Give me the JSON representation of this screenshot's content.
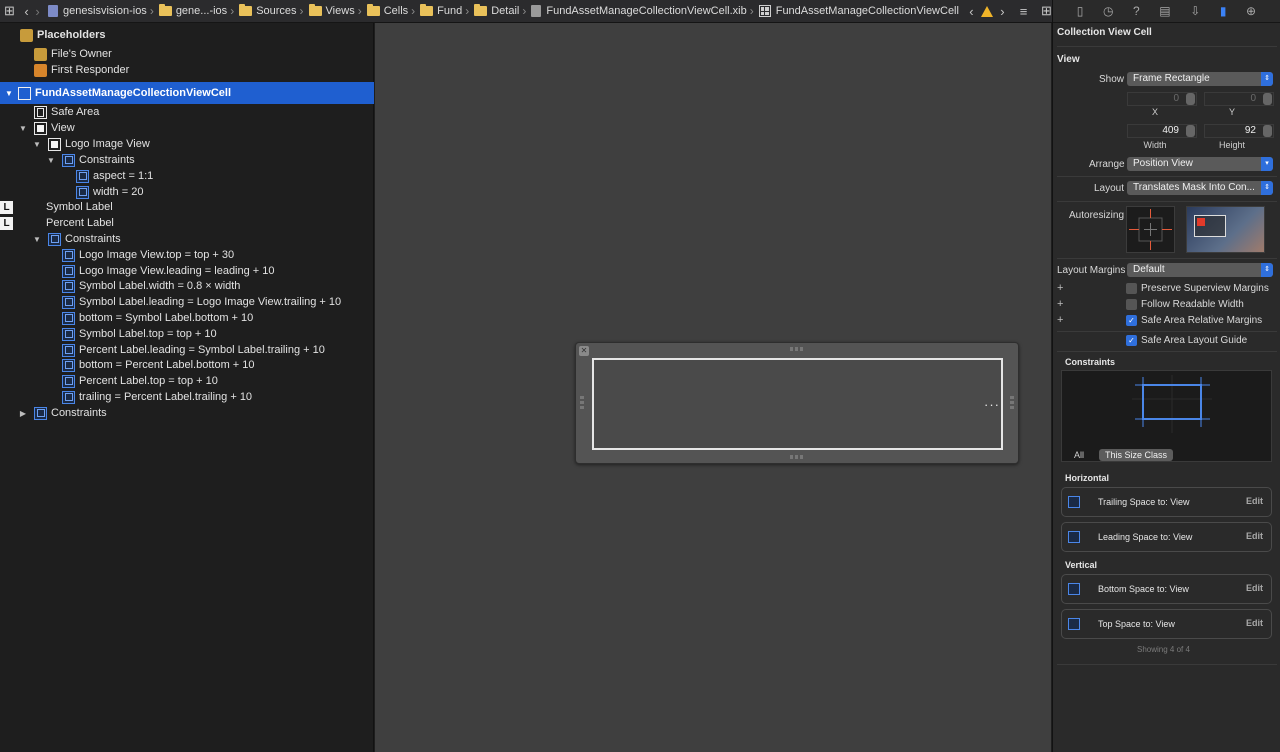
{
  "jumpbar": {
    "crumbs": [
      "genesisvision-ios",
      "gene...-ios",
      "Sources",
      "Views",
      "Cells",
      "Fund",
      "Detail",
      "FundAssetManageCollectionViewCell.xib",
      "FundAssetManageCollectionViewCell"
    ]
  },
  "outline": {
    "placeholders": "Placeholders",
    "files_owner": "File's Owner",
    "first_responder": "First Responder",
    "cell": "FundAssetManageCollectionViewCell",
    "safe_area": "Safe Area",
    "view": "View",
    "logo_image_view": "Logo Image View",
    "constraints": "Constraints",
    "aspect": "aspect = 1:1",
    "width20": "width = 20",
    "symbol_label": "Symbol Label",
    "percent_label": "Percent Label",
    "view_constraints": [
      "Logo Image View.top = top + 30",
      "Logo Image View.leading = leading + 10",
      "Symbol Label.width = 0.8 × width",
      "Symbol Label.leading = Logo Image View.trailing + 10",
      "bottom = Symbol Label.bottom + 10",
      "Symbol Label.top = top + 10",
      "Percent Label.leading = Symbol Label.trailing + 10",
      "bottom = Percent Label.bottom + 10",
      "Percent Label.top = top + 10",
      "trailing = Percent Label.trailing + 10"
    ],
    "cell_constraints": "Constraints"
  },
  "canvas": {
    "ellipsis": "···"
  },
  "inspector": {
    "header": "Collection View Cell",
    "view_section": "View",
    "show_label": "Show",
    "show_value": "Frame Rectangle",
    "x_value": "0",
    "y_value": "0",
    "x_label": "X",
    "y_label": "Y",
    "width_value": "409",
    "height_value": "92",
    "width_label": "Width",
    "height_label": "Height",
    "arrange_label": "Arrange",
    "arrange_value": "Position View",
    "layout_label": "Layout",
    "layout_value": "Translates Mask Into Con...",
    "autoresizing_label": "Autoresizing",
    "layout_margins_label": "Layout Margins",
    "layout_margins_value": "Default",
    "preserve_label": "Preserve Superview Margins",
    "readable_label": "Follow Readable Width",
    "safe_rel_label": "Safe Area Relative Margins",
    "safe_guide_label": "Safe Area Layout Guide",
    "constraints_section": "Constraints",
    "seg_all": "All",
    "seg_this": "This Size Class",
    "horizontal": "Horizontal",
    "vertical": "Vertical",
    "cards": [
      {
        "text": "Trailing Space to:  View",
        "edit": "Edit"
      },
      {
        "text": "Leading Space to:  View",
        "edit": "Edit"
      },
      {
        "text": "Bottom Space to:  View",
        "edit": "Edit"
      },
      {
        "text": "Top Space to:  View",
        "edit": "Edit"
      }
    ],
    "showing": "Showing 4 of 4",
    "accent": "#2f6fdc"
  }
}
